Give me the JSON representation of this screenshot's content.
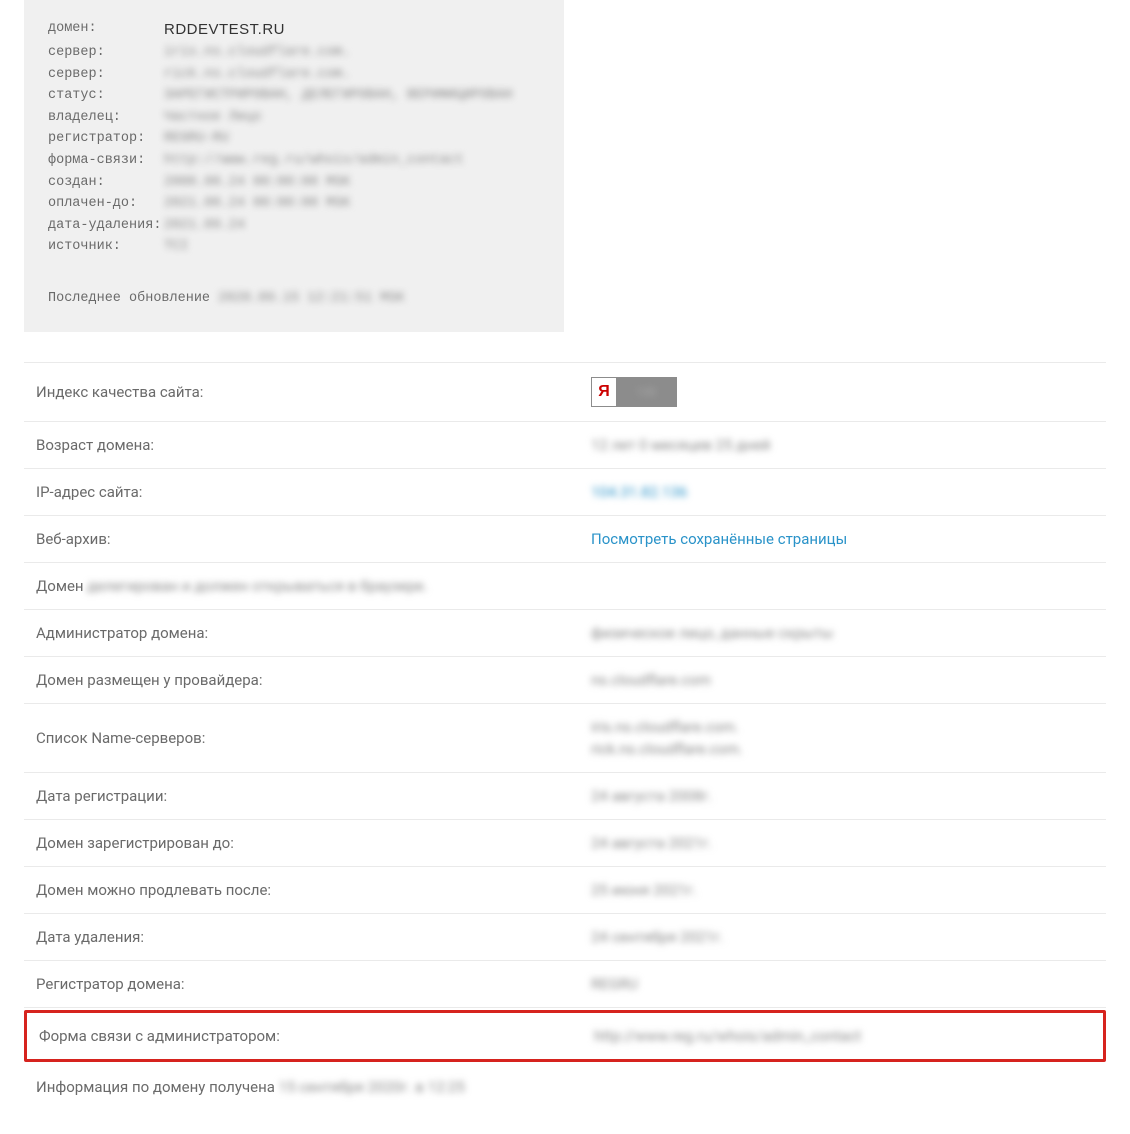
{
  "whois": {
    "rows": [
      {
        "label": "домен:",
        "value": "RDDEVTEST.RU",
        "value_class": "domain-name"
      },
      {
        "label": "сервер:",
        "value": "iris.ns.cloudflare.com.",
        "blurred": true
      },
      {
        "label": "сервер:",
        "value": "rick.ns.cloudflare.com.",
        "blurred": true
      },
      {
        "label": "статус:",
        "value": "ЗАРЕГИСТРИРОВАН, ДЕЛЕГИРОВАН, ВЕРИФИЦИРОВАН",
        "blurred": true
      },
      {
        "label": "владелец:",
        "value": "Частное Лицо",
        "blurred": true
      },
      {
        "label": "регистратор:",
        "value": "REGRU-RU",
        "blurred": true
      },
      {
        "label": "форма-связи:",
        "value": "http://www.reg.ru/whois/admin_contact",
        "blurred": true
      },
      {
        "label": "создан:",
        "value": "2008.08.24 00:00:00 MSK",
        "blurred": true
      },
      {
        "label": "оплачен-до:",
        "value": "2021.08.24 00:00:00 MSK",
        "blurred": true
      },
      {
        "label": "дата-удаления:",
        "value": "2021.09.24",
        "blurred": true
      },
      {
        "label": "источник:",
        "value": "TCI",
        "blurred": true
      }
    ],
    "update_label": "Последнее обновление",
    "update_value": "2020.09.15 12:21:51 MSK"
  },
  "info": {
    "quality_label": "Индекс качества сайта:",
    "quality_ya": "Я",
    "quality_score": "130",
    "age_label": "Возраст домена:",
    "age_value": "12 лет 0 месяцев 25 дней",
    "ip_label": "IP-адрес сайта:",
    "ip_value": "104.31.82.136",
    "archive_label": "Веб-архив:",
    "archive_value": "Посмотреть сохранённые страницы",
    "delegated_prefix": "Домен ",
    "delegated_text": "делегирован и должен открываться в браузере.",
    "admin_label": "Администратор домена:",
    "admin_value": "физическое лицо, данные скрыты",
    "provider_label": "Домен размещен у провайдера:",
    "provider_value": "ns.cloudflare.com",
    "ns_label": "Список Name-серверов:",
    "ns_value1": "iris.ns.cloudflare.com.",
    "ns_value2": "rick.ns.cloudflare.com.",
    "regdate_label": "Дата регистрации:",
    "regdate_value": "24 августа 2008г.",
    "until_label": "Домен зарегистрирован до:",
    "until_value": "24 августа 2021г.",
    "renew_label": "Домен можно продлевать после:",
    "renew_value": "25 июня 2021г.",
    "delete_label": "Дата удаления:",
    "delete_value": "24 сентября 2021г.",
    "registrar_label": "Регистратор домена:",
    "registrar_value": "REGRU",
    "contact_label": "Форма связи с администратором:",
    "contact_value": "http://www.reg.ru/whois/admin_contact",
    "footer_prefix": "Информация по домену получена ",
    "footer_date": "15 сентября 2020г. в 12:25"
  }
}
